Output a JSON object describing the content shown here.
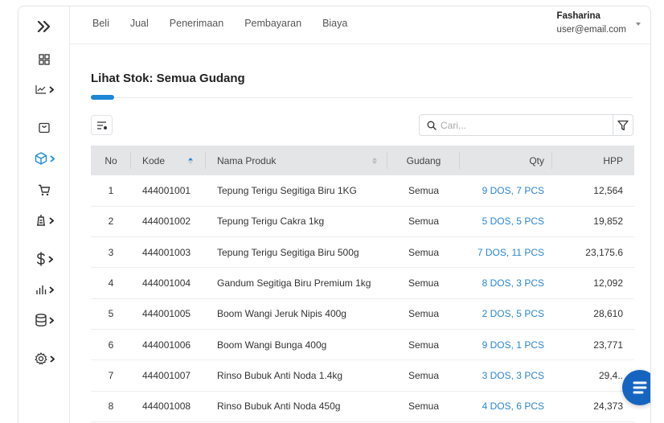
{
  "topnav": {
    "items": [
      "Beli",
      "Jual",
      "Penerimaan",
      "Pembayaran",
      "Biaya"
    ]
  },
  "user": {
    "name": "Fasharina",
    "email": "user@email.com"
  },
  "sidebar": {
    "items": [
      {
        "icon": "double-chevron-right-icon"
      },
      {
        "icon": "grid-icon"
      },
      {
        "icon": "chart-line-icon",
        "has_submenu": true
      },
      {
        "icon": "shopping-bag-icon"
      },
      {
        "icon": "box-icon",
        "has_submenu": true,
        "active": true
      },
      {
        "icon": "cart-icon"
      },
      {
        "icon": "tower-icon",
        "has_submenu": true
      },
      {
        "icon": "dollar-icon",
        "has_submenu": true
      },
      {
        "icon": "bar-chart-icon",
        "has_submenu": true
      },
      {
        "icon": "database-icon",
        "has_submenu": true
      },
      {
        "icon": "gear-icon",
        "has_submenu": true
      }
    ]
  },
  "page": {
    "title": "Lihat Stok: Semua Gudang"
  },
  "search": {
    "placeholder": "Cari..."
  },
  "table": {
    "headers": {
      "no": "No",
      "kode": "Kode",
      "nama": "Nama Produk",
      "gudang": "Gudang",
      "qty": "Qty",
      "hpp": "HPP"
    },
    "rows": [
      {
        "no": "1",
        "kode": "444001001",
        "nama": "Tepung Terigu Segitiga Biru 1KG",
        "gudang": "Semua",
        "qty": "9 DOS, 7 PCS",
        "hpp": "12,564"
      },
      {
        "no": "2",
        "kode": "444001002",
        "nama": "Tepung Terigu Cakra 1kg",
        "gudang": "Semua",
        "qty": "5 DOS, 5 PCS",
        "hpp": "19,852"
      },
      {
        "no": "3",
        "kode": "444001003",
        "nama": "Tepung Terigu Segitiga Biru 500g",
        "gudang": "Semua",
        "qty": "7 DOS, 11 PCS",
        "hpp": "23,175.6"
      },
      {
        "no": "4",
        "kode": "444001004",
        "nama": "Gandum Segitiga Biru Premium 1kg",
        "gudang": "Semua",
        "qty": "8 DOS, 3 PCS",
        "hpp": "12,092"
      },
      {
        "no": "5",
        "kode": "444001005",
        "nama": "Boom Wangi Jeruk Nipis 400g",
        "gudang": "Semua",
        "qty": "2 DOS, 5 PCS",
        "hpp": "28,610"
      },
      {
        "no": "6",
        "kode": "444001006",
        "nama": "Boom Wangi Bunga 400g",
        "gudang": "Semua",
        "qty": "9 DOS, 1 PCS",
        "hpp": "23,771"
      },
      {
        "no": "7",
        "kode": "444001007",
        "nama": "Rinso Bubuk Anti Noda 1.4kg",
        "gudang": "Semua",
        "qty": "3 DOS, 3 PCS",
        "hpp": "29,4.."
      },
      {
        "no": "8",
        "kode": "444001008",
        "nama": "Rinso Bubuk Anti Noda 450g",
        "gudang": "Semua",
        "qty": "4 DOS, 6 PCS",
        "hpp": "24,373"
      }
    ]
  },
  "colors": {
    "accent": "#1e88d6",
    "link": "#2a86cf",
    "header_bg": "#e4e5e7",
    "chat_fab": "#1565c0"
  }
}
